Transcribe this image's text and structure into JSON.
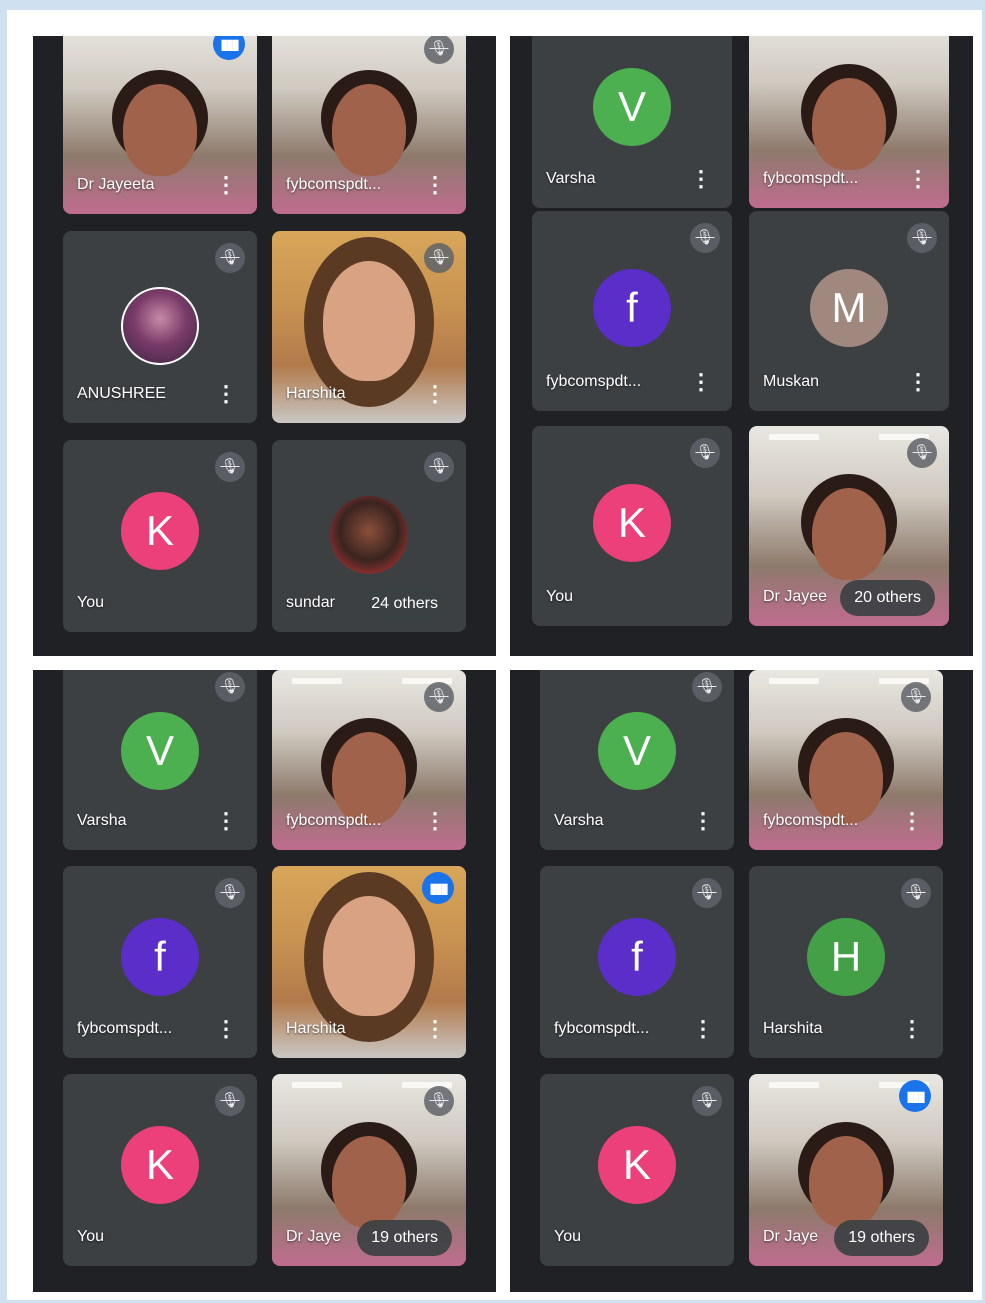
{
  "colors": {
    "green": "#4caf50",
    "purple": "#5b2ec9",
    "pink": "#ec407a",
    "brown": "#a1887f",
    "h_green": "#43a047",
    "bg": "#202124",
    "tile": "#3c4043"
  },
  "icons": {
    "mute": "mic-off-icon",
    "speaking": "speaking-icon",
    "more": "more-vert-icon"
  },
  "screens": [
    {
      "tiles": [
        {
          "name": "Dr Jayeeta",
          "type": "video",
          "speaking": true,
          "menu": true
        },
        {
          "name": "fybcomspdt...",
          "type": "video",
          "muted": true,
          "menu": true
        },
        {
          "name": "ANUSHREE",
          "type": "photo",
          "muted": true,
          "menu": true
        },
        {
          "name": "Harshita",
          "type": "girl",
          "muted": true,
          "menu": true
        },
        {
          "name": "You",
          "letter": "K",
          "color": "#ec407a",
          "muted": true
        },
        {
          "name": "sundar",
          "type": "photo2",
          "muted": true,
          "others": "24 others"
        }
      ]
    },
    {
      "tiles": [
        {
          "name": "Varsha",
          "letter": "V",
          "color": "#4caf50",
          "menu": true
        },
        {
          "name": "fybcomspdt...",
          "type": "video",
          "menu": true
        },
        {
          "name": "fybcomspdt...",
          "letter": "f",
          "color": "#5b2ec9",
          "muted": true,
          "menu": true
        },
        {
          "name": "Muskan",
          "letter": "M",
          "color": "#a1887f",
          "muted": true,
          "menu": true
        },
        {
          "name": "You",
          "letter": "K",
          "color": "#ec407a",
          "muted": true
        },
        {
          "name": "Dr Jayee",
          "type": "video",
          "muted": true,
          "others": "20 others"
        }
      ]
    },
    {
      "tiles": [
        {
          "name": "Varsha",
          "letter": "V",
          "color": "#4caf50",
          "muted": true,
          "menu": true
        },
        {
          "name": "fybcomspdt...",
          "type": "video",
          "muted": true,
          "menu": true
        },
        {
          "name": "fybcomspdt...",
          "letter": "f",
          "color": "#5b2ec9",
          "muted": true,
          "menu": true
        },
        {
          "name": "Harshita",
          "type": "girl",
          "speaking": true,
          "menu": true
        },
        {
          "name": "You",
          "letter": "K",
          "color": "#ec407a",
          "muted": true
        },
        {
          "name": "Dr Jaye",
          "type": "video",
          "muted": true,
          "others": "19 others"
        }
      ]
    },
    {
      "tiles": [
        {
          "name": "Varsha",
          "letter": "V",
          "color": "#4caf50",
          "muted": true,
          "menu": true
        },
        {
          "name": "fybcomspdt...",
          "type": "video",
          "muted": true,
          "menu": true
        },
        {
          "name": "fybcomspdt...",
          "letter": "f",
          "color": "#5b2ec9",
          "muted": true,
          "menu": true
        },
        {
          "name": "Harshita",
          "letter": "H",
          "color": "#43a047",
          "muted": true,
          "menu": true
        },
        {
          "name": "You",
          "letter": "K",
          "color": "#ec407a",
          "muted": true
        },
        {
          "name": "Dr Jaye",
          "type": "video",
          "speaking": true,
          "others": "19 others"
        }
      ]
    }
  ]
}
